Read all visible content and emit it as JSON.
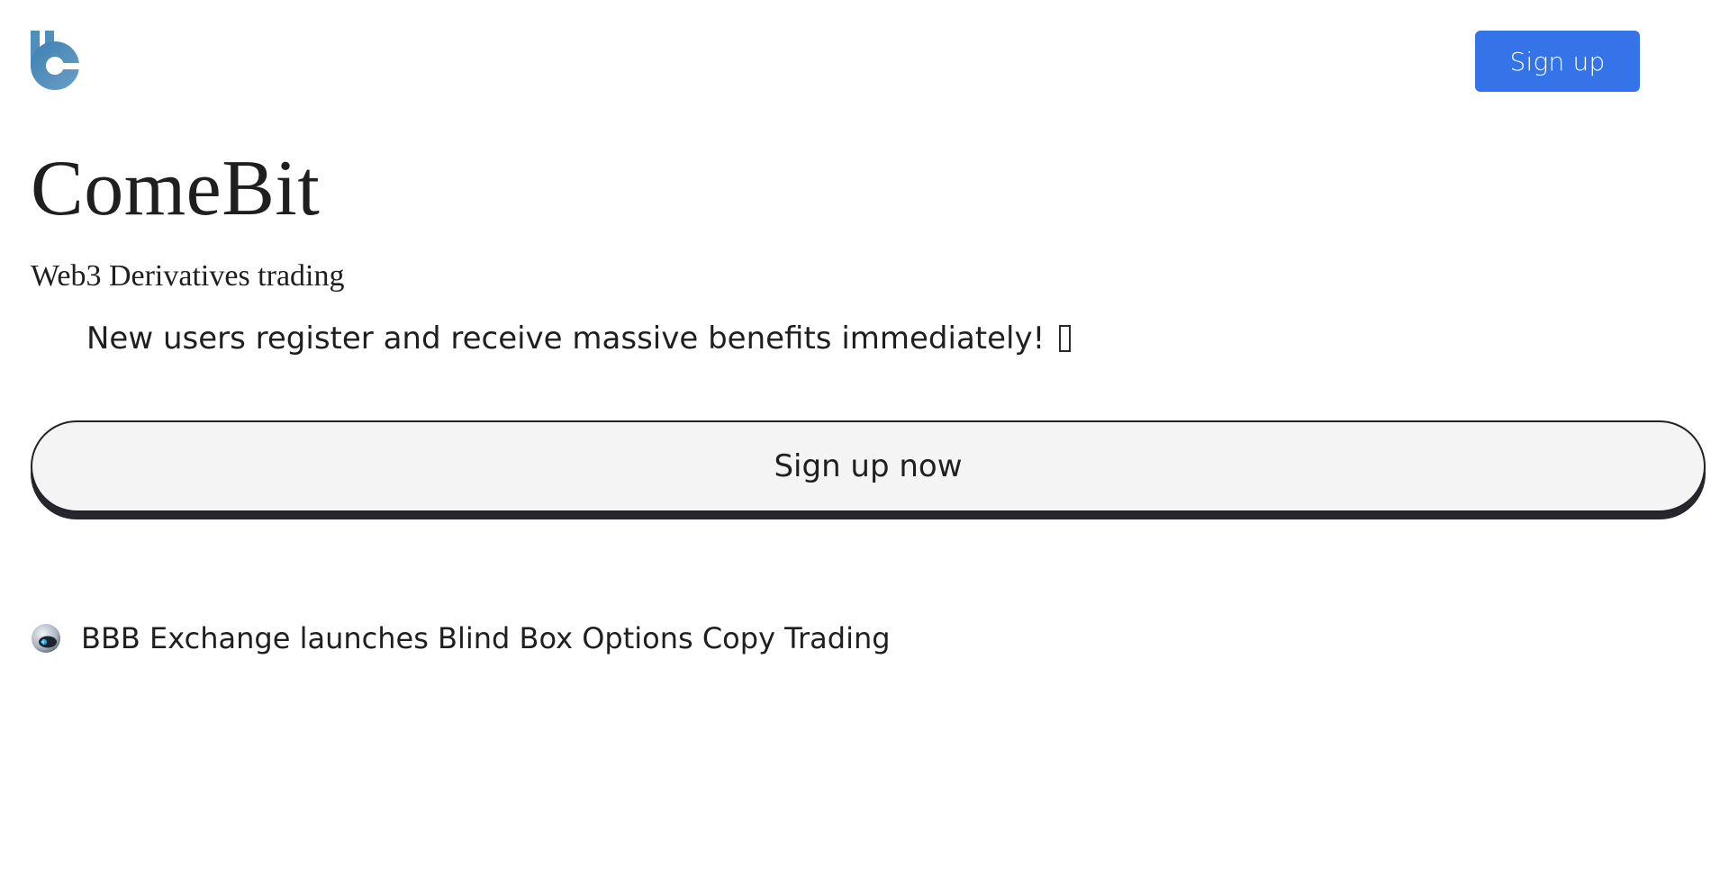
{
  "header": {
    "logo_icon": "comebit-logo-icon",
    "signup_label": "Sign up",
    "signup_color": "#3574e8"
  },
  "hero": {
    "title": "ComeBit",
    "tagline": "Web3 Derivatives trading",
    "promo_text": "New users register and receive massive benefits immediately!",
    "promo_glyph": "missing-glyph-icon",
    "cta_label": "Sign up now"
  },
  "news": {
    "icon": "robot-avatar-icon",
    "headline": "BBB Exchange launches Blind Box Options Copy Trading"
  }
}
